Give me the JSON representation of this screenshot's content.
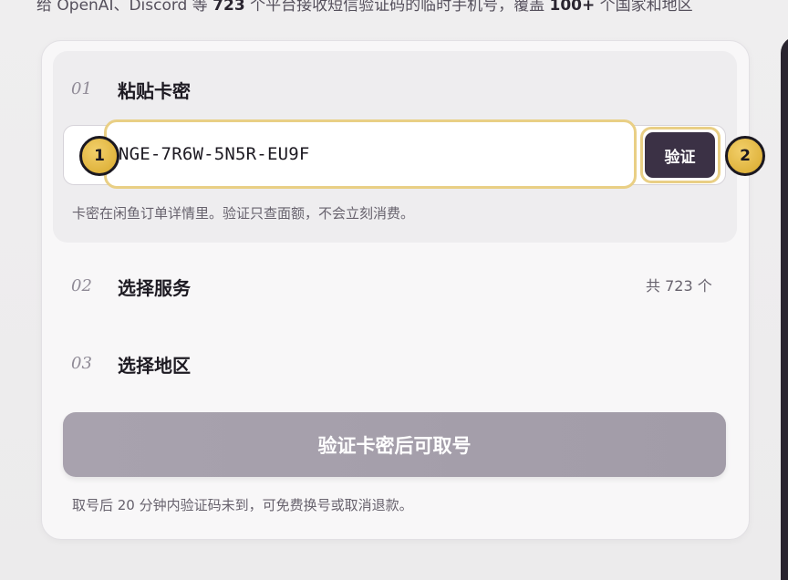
{
  "top_intro": {
    "prefix": "给 OpenAI、Discord 等 ",
    "service_count": "723",
    "middle": " 个平台接收短信验证码的临时手机号，覆盖 ",
    "region_count": "100+",
    "suffix": " 个国家和地区"
  },
  "step1": {
    "number": "01",
    "title": "粘贴卡密",
    "key_value": "NGE-7R6W-5N5R-EU9F",
    "verify_label": "验证",
    "hint": "卡密在闲鱼订单详情里。验证只查面额，不会立刻消费。"
  },
  "step2": {
    "number": "02",
    "title": "选择服务",
    "count_label": "共 723 个"
  },
  "step3": {
    "number": "03",
    "title": "选择地区"
  },
  "submit": {
    "label": "验证卡密后可取号"
  },
  "footer_hint": "取号后 20 分钟内验证码未到，可免费换号或取消退款。",
  "markers": [
    "1",
    "2"
  ],
  "colors": {
    "accent_dark": "#3b3145",
    "highlight": "#e9cf85",
    "marker_gold": "#e0b43e",
    "disabled_button": "#a8a2ae"
  }
}
